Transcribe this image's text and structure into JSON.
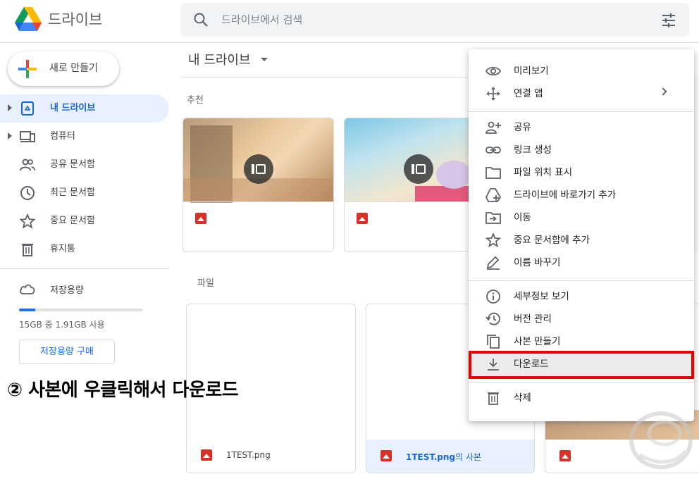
{
  "app": {
    "title": "드라이브"
  },
  "search": {
    "placeholder": "드라이브에서 검색"
  },
  "sidebar": {
    "new_label": "새로 만들기",
    "items": [
      {
        "label": "내 드라이브",
        "icon": "my-drive-icon",
        "active": true
      },
      {
        "label": "컴퓨터",
        "icon": "computer-icon"
      },
      {
        "label": "공유 문서함",
        "icon": "shared-icon"
      },
      {
        "label": "최근 문서함",
        "icon": "clock-icon"
      },
      {
        "label": "중요 문서함",
        "icon": "star-icon"
      },
      {
        "label": "휴지통",
        "icon": "trash-icon"
      }
    ],
    "storage": {
      "label": "저장용량",
      "usage": "15GB 중 1.91GB 사용",
      "used_fraction": 0.13,
      "buy_label": "저장용량 구매"
    }
  },
  "main": {
    "breadcrumb": "내 드라이브",
    "recommended_label": "추천",
    "files_label": "파일",
    "files": [
      {
        "name": "1TEST.png",
        "selected": false
      },
      {
        "name": "1TEST.png",
        "suffix": "의 사본",
        "selected": true
      }
    ]
  },
  "context_menu": {
    "items": [
      {
        "label": "미리보기",
        "icon": "eye-icon"
      },
      {
        "label": "연결 앱",
        "icon": "move-arrows-icon",
        "submenu": true
      },
      {
        "label": "공유",
        "icon": "person-add-icon"
      },
      {
        "label": "링크 생성",
        "icon": "link-icon"
      },
      {
        "label": "파일 위치 표시",
        "icon": "folder-icon"
      },
      {
        "label": "드라이브에 바로가기 추가",
        "icon": "drive-shortcut-icon"
      },
      {
        "label": "이동",
        "icon": "folder-move-icon"
      },
      {
        "label": "중요 문서함에 추가",
        "icon": "star-icon"
      },
      {
        "label": "이름 바꾸기",
        "icon": "pencil-icon"
      },
      {
        "label": "세부정보 보기",
        "icon": "info-icon"
      },
      {
        "label": "버전 관리",
        "icon": "history-icon"
      },
      {
        "label": "사본 만들기",
        "icon": "copy-icon"
      },
      {
        "label": "다운로드",
        "icon": "download-icon",
        "highlighted": true
      },
      {
        "label": "삭제",
        "icon": "trash-icon"
      }
    ]
  },
  "annotation": {
    "caption": "② 사본에 우클릭해서 다운로드",
    "highlight_color": "#ee0000"
  },
  "colors": {
    "accent": "#1a73e8",
    "active_bg": "#e8f0fe"
  }
}
